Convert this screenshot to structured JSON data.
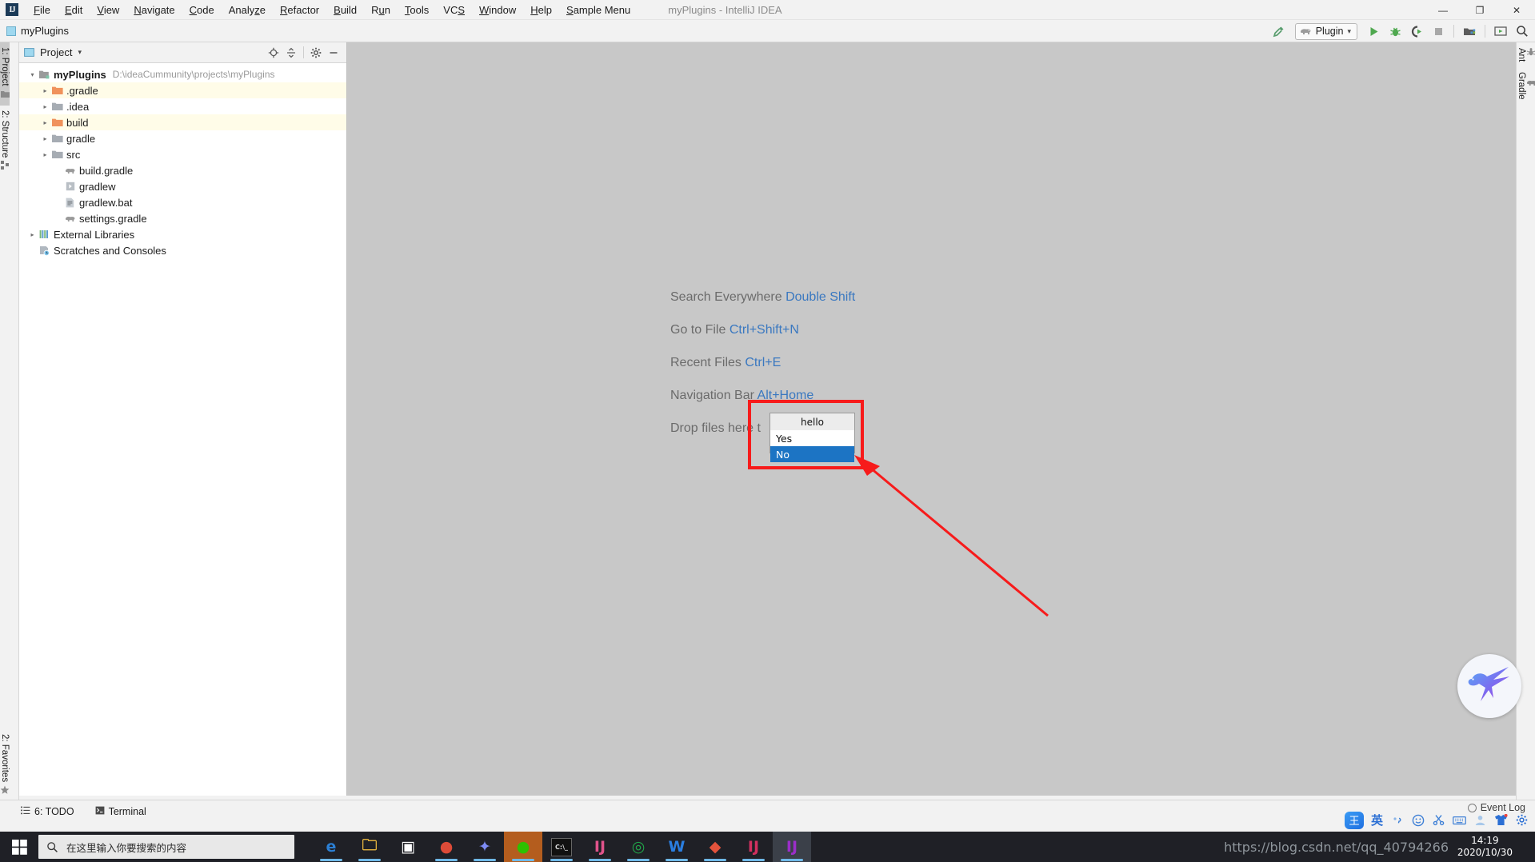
{
  "window": {
    "title": "myPlugins - IntelliJ IDEA",
    "app_logo": "IJ",
    "minimize": "—",
    "maximize": "❐",
    "close": "✕"
  },
  "menubar": {
    "items": [
      {
        "label": "File",
        "mnemonic": "F"
      },
      {
        "label": "Edit",
        "mnemonic": "E"
      },
      {
        "label": "View",
        "mnemonic": "V"
      },
      {
        "label": "Navigate",
        "mnemonic": "N"
      },
      {
        "label": "Code",
        "mnemonic": "C"
      },
      {
        "label": "Analyze",
        "mnemonic": "z"
      },
      {
        "label": "Refactor",
        "mnemonic": "R"
      },
      {
        "label": "Build",
        "mnemonic": "B"
      },
      {
        "label": "Run",
        "mnemonic": "u"
      },
      {
        "label": "Tools",
        "mnemonic": "T"
      },
      {
        "label": "VCS",
        "mnemonic": "S"
      },
      {
        "label": "Window",
        "mnemonic": "W"
      },
      {
        "label": "Help",
        "mnemonic": "H"
      },
      {
        "label": "Sample Menu",
        "mnemonic": "S"
      }
    ]
  },
  "toolbar": {
    "project_chip": "myPlugins",
    "build_icon": "hammer-icon",
    "run_config": {
      "label": "Plugin",
      "icon": "gradle-elephant-icon",
      "chevron": "▾"
    },
    "run_icon": "run-icon",
    "debug_icon": "debug-icon",
    "coverage_icon": "run-coverage-icon",
    "stop_icon": "stop-icon",
    "updates_icon": "update-project-icon",
    "presentation_icon": "presentation-icon",
    "search_icon": "search-icon"
  },
  "left_tabs": [
    {
      "label": "1: Project",
      "icon": "project-icon",
      "active": true
    },
    {
      "label": "2: Structure",
      "icon": "structure-icon",
      "active": false
    }
  ],
  "left_tabs_bottom": [
    {
      "label": "2: Favorites",
      "icon": "star-icon",
      "active": false
    }
  ],
  "right_tabs": [
    {
      "label": "Ant",
      "icon": "ant-icon"
    },
    {
      "label": "Gradle",
      "icon": "gradle-elephant-icon"
    }
  ],
  "project_panel": {
    "title": "Project",
    "chevron": "▾",
    "header_icons": [
      "locate-icon",
      "collapse-all-icon",
      "gear-icon",
      "hide-icon"
    ],
    "tree": [
      {
        "label": "myPlugins",
        "path": "D:\\ideaCummunity\\projects\\myPlugins",
        "icon": "module-icon",
        "depth": 0,
        "arrow": "▾",
        "bold": true,
        "excluded": false
      },
      {
        "label": ".gradle",
        "icon": "folder-orange-icon",
        "depth": 1,
        "arrow": "▸",
        "bold": false,
        "excluded": true
      },
      {
        "label": ".idea",
        "icon": "folder-gray-icon",
        "depth": 1,
        "arrow": "▸",
        "bold": false,
        "excluded": false
      },
      {
        "label": "build",
        "icon": "folder-orange-icon",
        "depth": 1,
        "arrow": "▸",
        "bold": false,
        "excluded": true
      },
      {
        "label": "gradle",
        "icon": "folder-gray-icon",
        "depth": 1,
        "arrow": "▸",
        "bold": false,
        "excluded": false
      },
      {
        "label": "src",
        "icon": "folder-gray-icon",
        "depth": 1,
        "arrow": "▸",
        "bold": false,
        "excluded": false
      },
      {
        "label": "build.gradle",
        "icon": "gradle-file-icon",
        "depth": 2,
        "arrow": "",
        "bold": false,
        "excluded": false
      },
      {
        "label": "gradlew",
        "icon": "script-icon",
        "depth": 2,
        "arrow": "",
        "bold": false,
        "excluded": false
      },
      {
        "label": "gradlew.bat",
        "icon": "bat-file-icon",
        "depth": 2,
        "arrow": "",
        "bold": false,
        "excluded": false
      },
      {
        "label": "settings.gradle",
        "icon": "gradle-file-icon",
        "depth": 2,
        "arrow": "",
        "bold": false,
        "excluded": false
      },
      {
        "label": "External Libraries",
        "icon": "libraries-icon",
        "depth": 0,
        "arrow": "▸",
        "bold": false,
        "excluded": false
      },
      {
        "label": "Scratches and Consoles",
        "icon": "scratches-icon",
        "depth": 0,
        "arrow": "",
        "bold": false,
        "excluded": false
      }
    ]
  },
  "editor": {
    "tips": [
      {
        "action": "Search Everywhere",
        "shortcut": "Double Shift"
      },
      {
        "action": "Go to File",
        "shortcut": "Ctrl+Shift+N"
      },
      {
        "action": "Recent Files",
        "shortcut": "Ctrl+E"
      },
      {
        "action": "Navigation Bar",
        "shortcut": "Alt+Home"
      },
      {
        "action": "Drop files here t",
        "shortcut": ""
      }
    ]
  },
  "popup": {
    "title": "hello",
    "options": [
      {
        "label": "Yes",
        "selected": false
      },
      {
        "label": "No",
        "selected": true
      }
    ]
  },
  "annotation": {
    "box_color": "#f71b1b",
    "arrow_color": "#f71b1b"
  },
  "floating_widget": {
    "name": "hummingbird-widget"
  },
  "statusbar": {
    "left_items": [
      {
        "label": "6: TODO",
        "icon": "todo-icon"
      },
      {
        "label": "Terminal",
        "icon": "terminal-icon"
      }
    ],
    "event_log": "Event Log"
  },
  "ime": {
    "logo": "王",
    "mode": "英",
    "icons": [
      "punctuation-icon",
      "emoji-icon",
      "scissors-icon",
      "keyboard-icon",
      "account-icon",
      "skin-icon",
      "settings-icon"
    ]
  },
  "taskbar": {
    "start_icon": "windows-start-icon",
    "search_placeholder": "在这里输入你要搜索的内容",
    "search_icon": "search-icon",
    "apps": [
      {
        "name": "edge-icon",
        "glyph": "e",
        "color": "#2b7fd4",
        "state": "running"
      },
      {
        "name": "file-explorer-icon",
        "glyph": "🗀",
        "color": "#f6c040",
        "state": "running"
      },
      {
        "name": "microsoft-store-icon",
        "glyph": "▣",
        "color": "#ffffff",
        "state": "none"
      },
      {
        "name": "chrome-icon",
        "glyph": "●",
        "color": "#dd4b38",
        "state": "running"
      },
      {
        "name": "bird-app-icon",
        "glyph": "✦",
        "color": "#7e8cf5",
        "state": "running"
      },
      {
        "name": "wechat-icon",
        "glyph": "●",
        "color": "#2dc100",
        "state": "active-wechat"
      },
      {
        "name": "command-prompt-icon",
        "glyph": "C:\\_",
        "color": "#111111",
        "state": "running"
      },
      {
        "name": "intellij-idea-icon",
        "glyph": "IJ",
        "color": "#e0538b",
        "state": "running"
      },
      {
        "name": "navicat-icon",
        "glyph": "◎",
        "color": "#21a64a",
        "state": "running"
      },
      {
        "name": "wps-icon",
        "glyph": "W",
        "color": "#2a7ee0",
        "state": "running"
      },
      {
        "name": "diamond-app-icon",
        "glyph": "◆",
        "color": "#e3533c",
        "state": "running"
      },
      {
        "name": "intellij-idea-icon-2",
        "glyph": "IJ",
        "color": "#d1305f",
        "state": "running"
      },
      {
        "name": "intellij-idea-icon-3",
        "glyph": "IJ",
        "color": "#9b2ec9",
        "state": "active-idea"
      }
    ],
    "clock_time": "14:19",
    "clock_date": "2020/10/30"
  },
  "watermark": "https://blog.csdn.net/qq_40794266"
}
